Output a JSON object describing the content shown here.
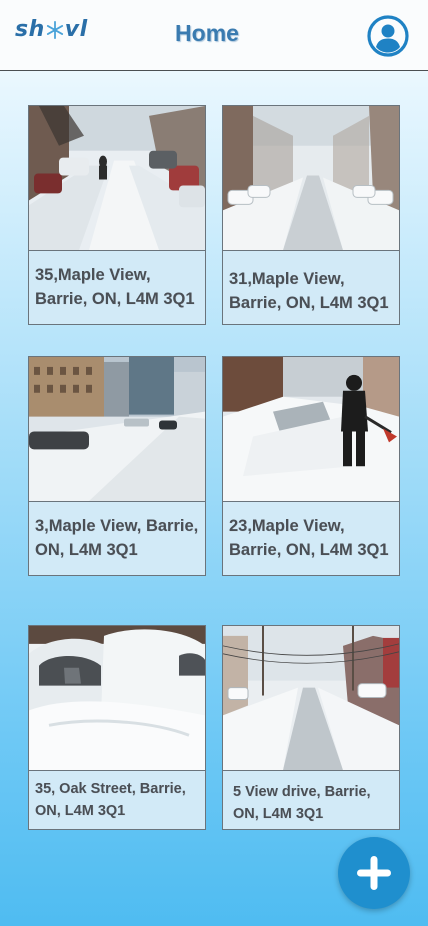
{
  "header": {
    "logo_part1": "sh",
    "logo_part2": "vl",
    "title": "Home",
    "profile_icon": "user-circle-icon"
  },
  "listings": [
    {
      "address": "35,Maple View, Barrie, ON, L4M 3Q1",
      "image": "snowy-street-pedestrian"
    },
    {
      "address": "31,Maple View, Barrie, ON, L4M 3Q1",
      "image": "snowy-residential-street"
    },
    {
      "address": "3,Maple View, Barrie, ON, L4M 3Q1",
      "image": "snowy-city-road"
    },
    {
      "address": "23,Maple View, Barrie, ON, L4M 3Q1",
      "image": "person-shoveling-snow"
    },
    {
      "address": "35, Oak Street, Barrie, ON, L4M 3Q1",
      "image": "snow-covered-cars"
    },
    {
      "address": "5 View drive, Barrie, ON, L4M 3Q1",
      "image": "snowy-town-street"
    }
  ],
  "fab": {
    "icon": "plus-icon"
  },
  "colors": {
    "brand": "#2a6fa8",
    "title": "#3a7bb0",
    "fab": "#1f8fce",
    "card_bg": "#d2eaf7"
  }
}
